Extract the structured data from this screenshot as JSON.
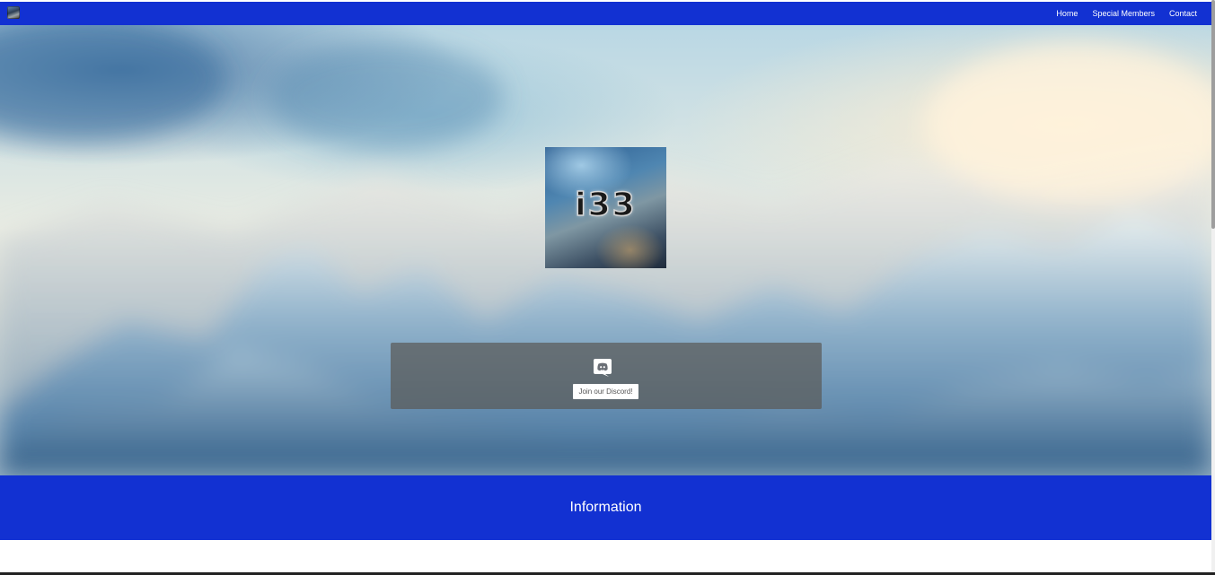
{
  "navbar": {
    "logo_icon": "guild-logo-thumbnail-icon",
    "links": [
      {
        "label": "Home"
      },
      {
        "label": "Special Members"
      },
      {
        "label": "Contact"
      }
    ],
    "background_color": "#1231d2"
  },
  "hero": {
    "logo_text": "i33",
    "discord": {
      "icon": "discord-icon",
      "button_label": "Join our Discord!"
    }
  },
  "info": {
    "title": "Information",
    "background_color": "#1231d2"
  }
}
